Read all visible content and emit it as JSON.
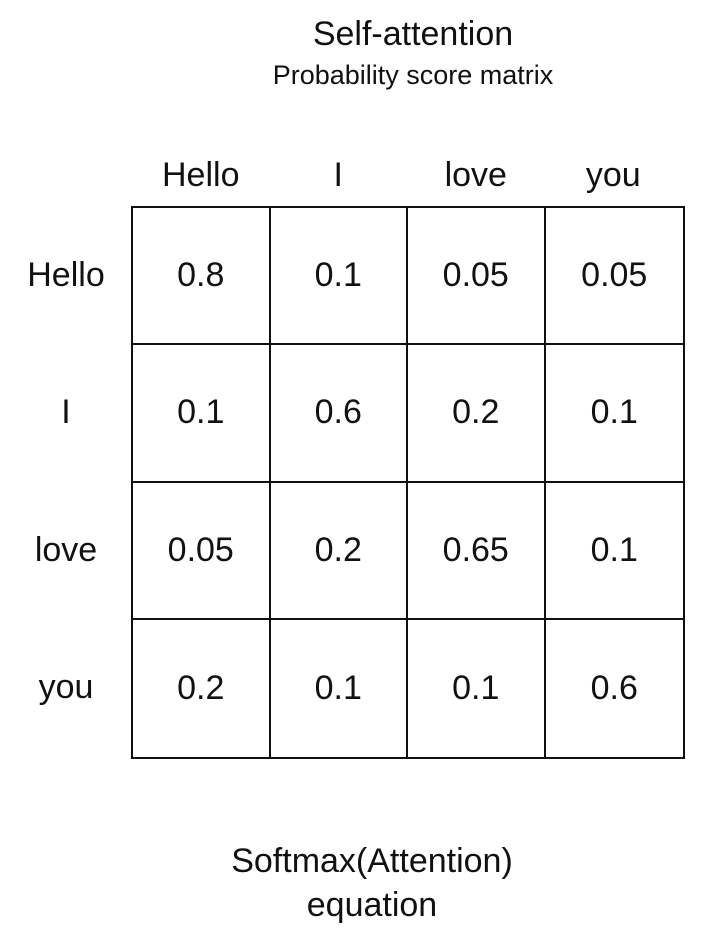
{
  "title": "Self-attention",
  "subtitle": "Probability score matrix",
  "columns": [
    "Hello",
    "I",
    "love",
    "you"
  ],
  "rows": [
    "Hello",
    "I",
    "love",
    "you"
  ],
  "matrix": [
    [
      "0.8",
      "0.1",
      "0.05",
      "0.05"
    ],
    [
      "0.1",
      "0.6",
      "0.2",
      "0.1"
    ],
    [
      "0.05",
      "0.2",
      "0.65",
      "0.1"
    ],
    [
      "0.2",
      "0.1",
      "0.1",
      "0.6"
    ]
  ],
  "footer": {
    "line1": "Softmax(Attention)",
    "line2": "equation"
  }
}
